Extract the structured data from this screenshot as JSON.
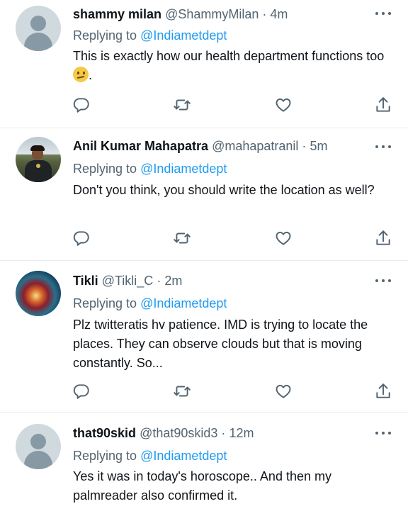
{
  "tweets": [
    {
      "name": "shammy milan",
      "handle": "@ShammyMilan",
      "dot": "·",
      "time": "4m",
      "reply_prefix": "Replying to",
      "reply_to": "@Indiametdept",
      "text": "This is exactly how our health department functions too",
      "text_suffix": ".",
      "avatar": "default-avatar"
    },
    {
      "name": "Anil Kumar Mahapatra",
      "handle": "@mahapatranil",
      "dot": "·",
      "time": "5m",
      "reply_prefix": "Replying to",
      "reply_to": "@Indiametdept",
      "text": "Don't you think, you should write the location as well?",
      "avatar": "photo-avatar-person"
    },
    {
      "name": "Tikli",
      "handle": "@Tikli_C",
      "dot": "·",
      "time": "2m",
      "reply_prefix": "Replying to",
      "reply_to": "@Indiametdept",
      "text": "Plz twitteratis hv patience. IMD is trying to locate the places. They can observe clouds but that is moving constantly. So...",
      "avatar": "photo-avatar-nebula"
    },
    {
      "name": "that90skid",
      "handle": "@that90skid3",
      "dot": "·",
      "time": "12m",
      "reply_prefix": "Replying to",
      "reply_to": "@Indiametdept",
      "text": "Yes it was in today's horoscope.. And then my palmreader also confirmed it.",
      "avatar": "default-avatar"
    }
  ],
  "icons": {
    "reply": "reply-icon",
    "retweet": "retweet-icon",
    "like": "like-icon",
    "share": "share-icon",
    "more": "more-icon"
  },
  "colors": {
    "link": "#1d9bf0",
    "secondary": "#536471",
    "primary": "#0f1419"
  }
}
